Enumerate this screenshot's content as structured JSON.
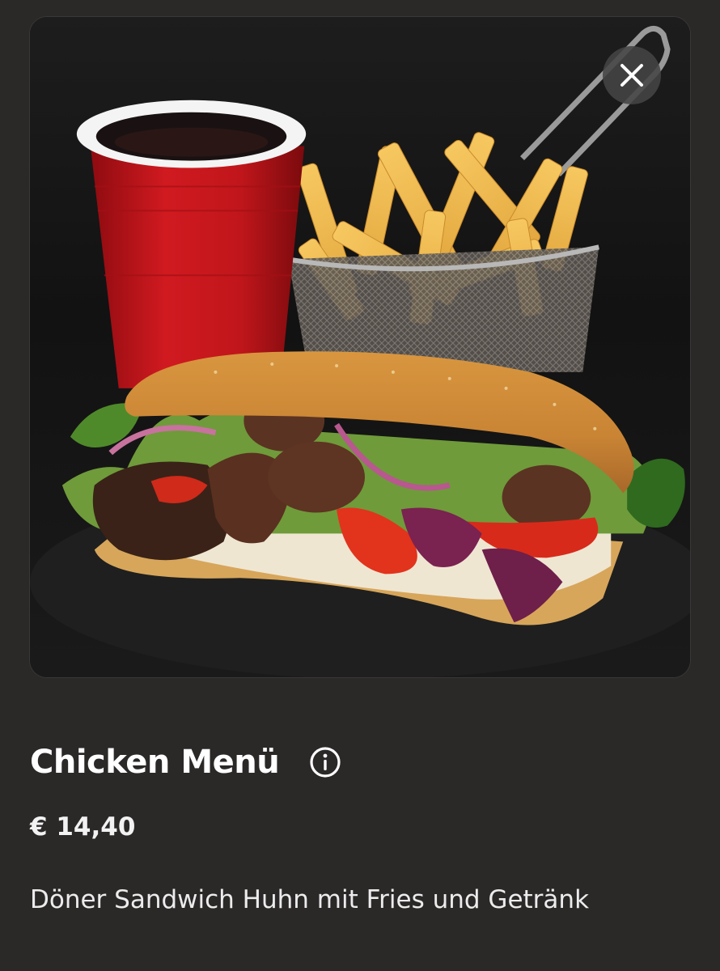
{
  "product": {
    "title": "Chicken Menü",
    "price": "€ 14,40",
    "description": "Döner Sandwich Huhn mit Fries und Getränk"
  },
  "icons": {
    "close": "close-icon",
    "info": "info-icon"
  },
  "colors": {
    "background": "#2b2828",
    "text": "#ffffff",
    "close_button_bg": "#464444"
  }
}
